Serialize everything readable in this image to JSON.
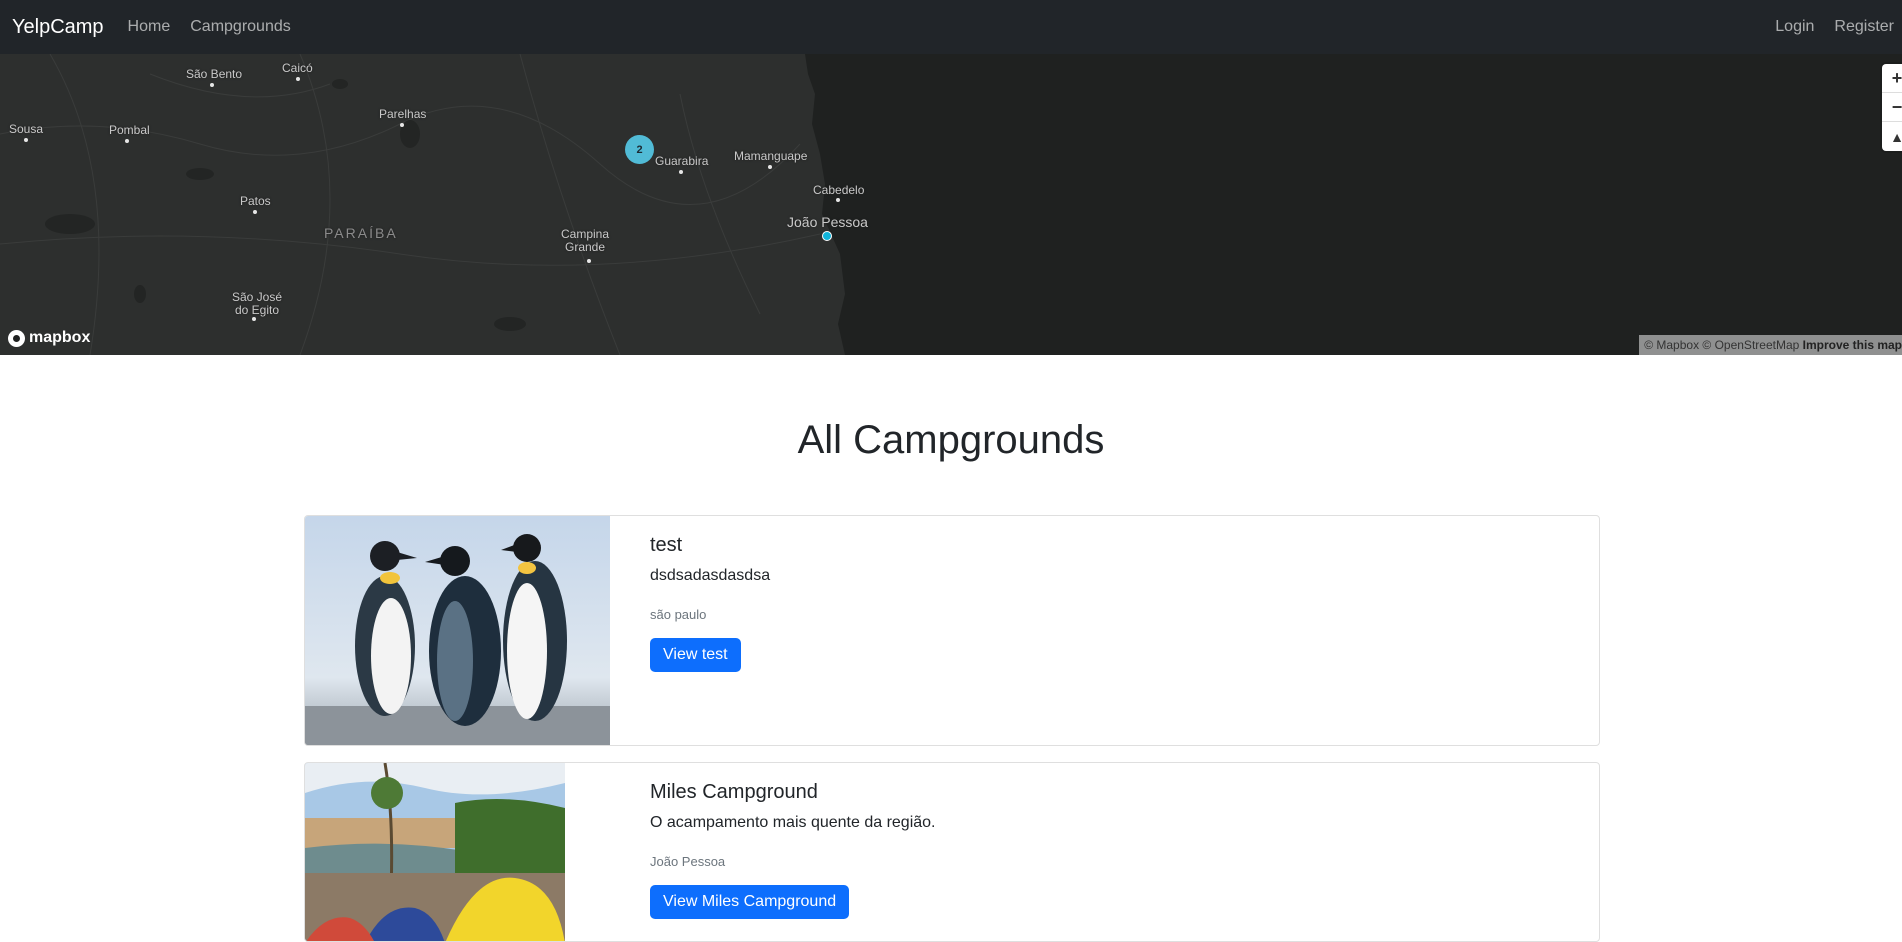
{
  "navbar": {
    "brand": "YelpCamp",
    "links": [
      "Home",
      "Campgrounds"
    ],
    "right_links": [
      "Login",
      "Register"
    ]
  },
  "map": {
    "places": {
      "sao_bento": "São Bento",
      "caico": "Caicó",
      "sousa": "Sousa",
      "pombal": "Pombal",
      "parelhas": "Parelhas",
      "guarabira": "Guarabira",
      "mamanguape": "Mamanguape",
      "cabedelo": "Cabedelo",
      "joao_pessoa": "João Pessoa",
      "patos": "Patos",
      "paraiba": "PARAÍBA",
      "campina_grande": "Campina\nGrande",
      "sao_jose_do_egito": "São José\ndo Egito"
    },
    "cluster_count": "2",
    "zoom_in": "+",
    "zoom_out": "−",
    "compass": "▲",
    "logo": "mapbox",
    "attribution": "© Mapbox © OpenStreetMap",
    "attribution_link": "Improve this map",
    "colors": {
      "cluster": "#51bbd6",
      "point": "#11b4da",
      "land": "#2e302f",
      "water": "#1f2120"
    }
  },
  "page": {
    "title": "All Campgrounds"
  },
  "campgrounds": [
    {
      "title": "test",
      "description": "dsdsadasdasdsa",
      "location": "são paulo",
      "button": "View test",
      "image": "penguins"
    },
    {
      "title": "Miles Campground",
      "description": "O acampamento mais quente da região.",
      "location": "João Pessoa",
      "button": "View Miles Campground",
      "image": "tents-by-river"
    }
  ],
  "colors": {
    "navbar": "#212529",
    "primary_button": "#0d6efd"
  }
}
